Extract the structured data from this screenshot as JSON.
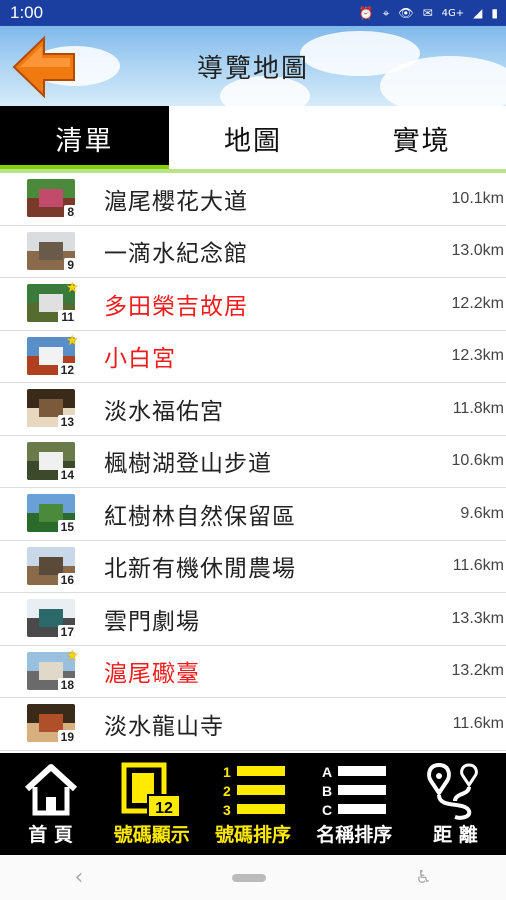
{
  "status": {
    "time": "1:00",
    "network": "4G+",
    "icons": [
      "alarm-icon",
      "location-icon",
      "eye-icon",
      "mail-icon",
      "signal-icon",
      "battery-icon"
    ]
  },
  "header": {
    "title": "導覽地圖"
  },
  "tabs": [
    {
      "label": "清單",
      "active": true
    },
    {
      "label": "地圖",
      "active": false
    },
    {
      "label": "實境",
      "active": false
    }
  ],
  "items": [
    {
      "num": "8",
      "name": "滬尾櫻花大道",
      "distance": "10.1km",
      "red": false,
      "star": false
    },
    {
      "num": "9",
      "name": "一滴水紀念館",
      "distance": "13.0km",
      "red": false,
      "star": false
    },
    {
      "num": "11",
      "name": "多田榮吉故居",
      "distance": "12.2km",
      "red": true,
      "star": true
    },
    {
      "num": "12",
      "name": "小白宮",
      "distance": "12.3km",
      "red": true,
      "star": true
    },
    {
      "num": "13",
      "name": "淡水福佑宮",
      "distance": "11.8km",
      "red": false,
      "star": false
    },
    {
      "num": "14",
      "name": "楓樹湖登山步道",
      "distance": "10.6km",
      "red": false,
      "star": false
    },
    {
      "num": "15",
      "name": "紅樹林自然保留區",
      "distance": "9.6km",
      "red": false,
      "star": false
    },
    {
      "num": "16",
      "name": "北新有機休閒農場",
      "distance": "11.6km",
      "red": false,
      "star": false
    },
    {
      "num": "17",
      "name": "雲門劇場",
      "distance": "13.3km",
      "red": false,
      "star": false
    },
    {
      "num": "18",
      "name": "滬尾礮臺",
      "distance": "13.2km",
      "red": true,
      "star": true
    },
    {
      "num": "19",
      "name": "淡水龍山寺",
      "distance": "11.6km",
      "red": false,
      "star": false
    }
  ],
  "toolbar": {
    "home": "首 頁",
    "number_display": "號碼顯示",
    "number_badge": "12",
    "number_sort": "號碼排序",
    "name_sort": "名稱排序",
    "distance": "距 離"
  },
  "colors": {
    "status_bar": "#1a3fa0",
    "highlight_red": "#ee1c1c",
    "toolbar_yellow": "#ffea00",
    "tab_underline": "#8ad000"
  }
}
